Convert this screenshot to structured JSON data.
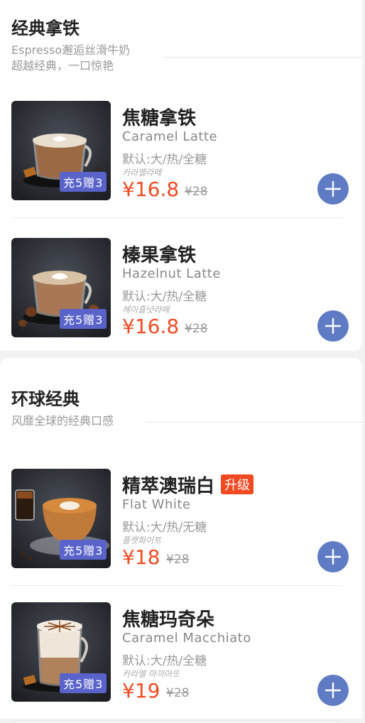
{
  "sections": [
    {
      "title": "经典拿铁",
      "subtitle_lines": [
        "Espresso邂逅丝滑牛奶",
        "超越经典，一口惊艳"
      ],
      "products": [
        {
          "name": "焦糖拿铁",
          "name_en": "Caramel Latte",
          "options": "默认:大/热/全糖",
          "korean": "카라멜라떼",
          "promo": "充5赠3",
          "price": "¥16.8",
          "original_price": "¥28",
          "upgrade_badge": ""
        },
        {
          "name": "榛果拿铁",
          "name_en": "Hazelnut Latte",
          "options": "默认:大/热/全糖",
          "korean": "헤이즐넛라떼",
          "promo": "充5赠3",
          "price": "¥16.8",
          "original_price": "¥28",
          "upgrade_badge": ""
        }
      ]
    },
    {
      "title": "环球经典",
      "subtitle_lines": [
        "风靡全球的经典口感"
      ],
      "products": [
        {
          "name": "精萃澳瑞白",
          "name_en": "Flat White",
          "options": "默认:大/热/无糖",
          "korean": "플랫화이트",
          "promo": "充5赠3",
          "price": "¥18",
          "original_price": "¥28",
          "upgrade_badge": "升级"
        },
        {
          "name": "焦糖玛奇朵",
          "name_en": "Caramel Macchiato",
          "options": "默认:大/热/全糖",
          "korean": "카라멜 마끼아또",
          "promo": "充5赠3",
          "price": "¥19",
          "original_price": "¥28",
          "upgrade_badge": ""
        }
      ]
    }
  ],
  "colors": {
    "price": "#f04a22",
    "promo_badge": "#5a63c9",
    "add_button": "#5f7bc4",
    "upgrade_badge": "#f04a22"
  },
  "icons": {
    "add": "plus-circle-icon"
  }
}
